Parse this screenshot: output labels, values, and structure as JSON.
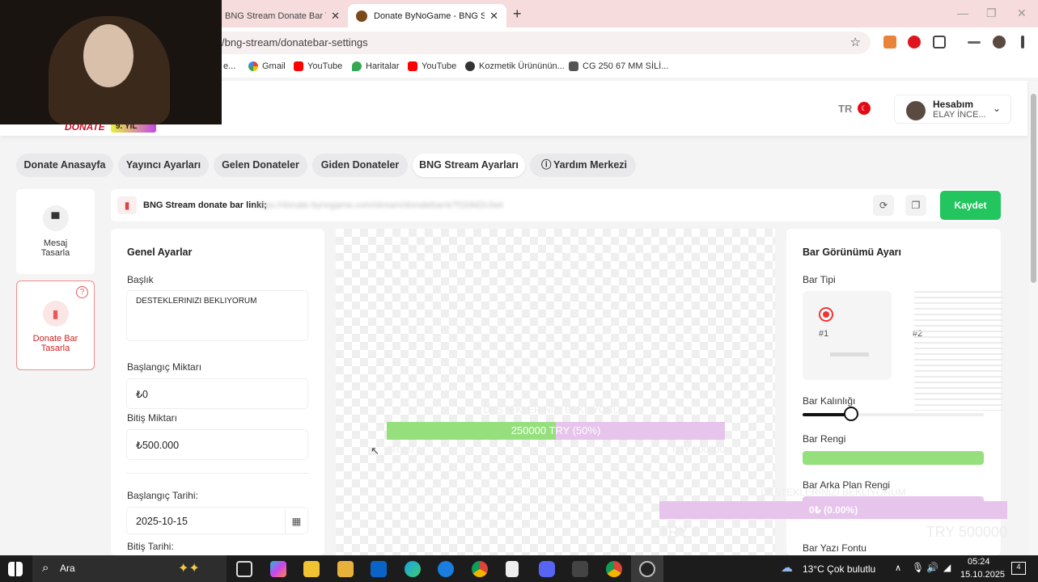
{
  "browser": {
    "tabs": [
      {
        "title": "BNG Stream Donate Bar Ta",
        "active": false
      },
      {
        "title": "Donate ByNoGame - BNG Strea",
        "active": true
      }
    ],
    "url": "/bng-stream/donatebar-settings",
    "bookmarks": [
      "e...",
      "Gmail",
      "YouTube",
      "Haritalar",
      "YouTube",
      "Kozmetik Ürününün...",
      "CG 250 67 MM SİLİ..."
    ]
  },
  "site": {
    "brand": "DONATE",
    "badge": "9. YIL",
    "lang": "TR",
    "account": {
      "line1": "Hesabım",
      "line2": "ELAY İNCE..."
    }
  },
  "nav": {
    "tabs": [
      {
        "label": "Donate Anasayfa"
      },
      {
        "label": "Yayıncı Ayarları"
      },
      {
        "label": "Gelen Donateler"
      },
      {
        "label": "Giden Donateler"
      },
      {
        "label": "BNG Stream Ayarları"
      },
      {
        "label": "Yardım Merkezi"
      }
    ]
  },
  "sidebar": {
    "items": [
      {
        "label1": "Mesaj",
        "label2": "Tasarla",
        "active": false
      },
      {
        "label1": "Donate Bar",
        "label2": "Tasarla",
        "active": true
      }
    ],
    "help": "?"
  },
  "linkbar": {
    "label": "BNG Stream donate bar linki;",
    "url": "https://donate.bynogame.com/stream/donatebar/e7f1b9d2c3a4",
    "save": "Kaydet"
  },
  "general": {
    "title": "Genel Ayarlar",
    "baslik_label": "Başlık",
    "baslik_value": "DESTEKLERINIZI BEKLIYORUM",
    "start_amount_label": "Başlangıç Miktarı",
    "start_amount_value": "₺0",
    "end_amount_label": "Bitiş Miktarı",
    "end_amount_value": "₺500.000",
    "start_date_label": "Başlangıç Tarihi:",
    "start_date_value": "2025-10-15",
    "end_date_label": "Bitiş Tarihi:"
  },
  "preview": {
    "bar1": {
      "title": "DESTEKLERINIZI BEKLIYORUM",
      "text": "250000 TRY (50%)",
      "progress": 0.5,
      "left": "TRY 0",
      "right": "TRY 500000"
    },
    "bar2": {
      "title": "DESTEKLERINIZI BEKLIYORUM",
      "text": "0₺ (0.00%)",
      "progress": 0.0,
      "left": "TRY 0",
      "right": "TRY 500000"
    }
  },
  "appearance": {
    "title": "Bar Görünümü Ayarı",
    "type_label": "Bar Tipi",
    "type1": "#1",
    "type2": "#2",
    "thickness_label": "Bar Kalınlığı",
    "thickness_level": 0.27,
    "color_label": "Bar Rengi",
    "bar_color": "#95e07d",
    "bg_color_label": "Bar Arka Plan Rengi",
    "bg_color": "#e6c4ec",
    "font_label": "Bar Yazı Fontu"
  },
  "taskbar": {
    "search": "Ara",
    "weather": "13°C  Çok bulutlu",
    "time": "05:24",
    "date": "15.10.2025",
    "notif": "4"
  }
}
